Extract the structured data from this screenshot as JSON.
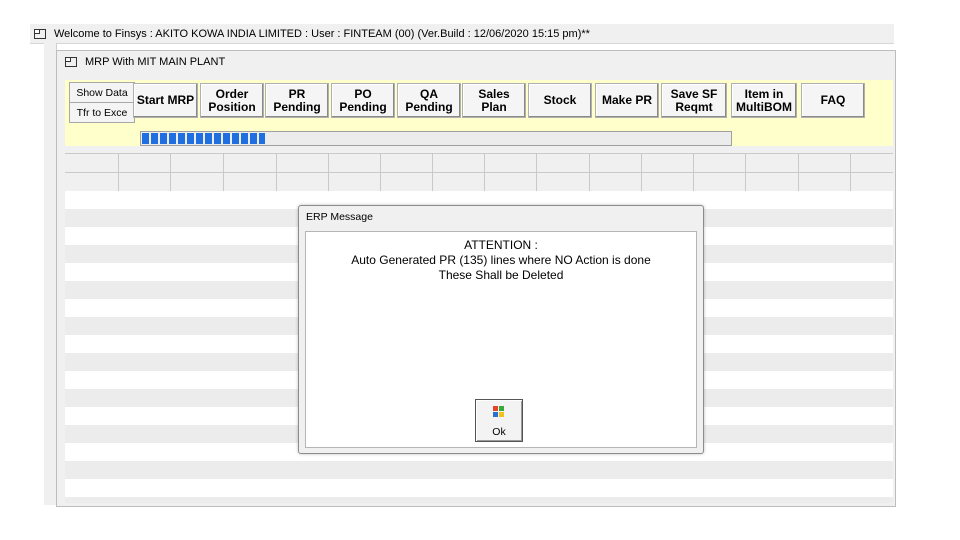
{
  "app": {
    "title": "Welcome to Finsys : AKITO KOWA INDIA LIMITED : User : FINTEAM (00) (Ver.Build : 12/06/2020  15:15 pm)**"
  },
  "window": {
    "title": "MRP With MIT MAIN PLANT"
  },
  "side_buttons": [
    "Show Data",
    "Tfr to Exce"
  ],
  "toolbar": [
    "Start MRP",
    "Order\nPosition",
    "PR\nPending",
    "PO\nPending",
    "QA\nPending",
    "Sales\nPlan",
    "Stock",
    "Make PR",
    "Save SF\nReqmt",
    "Item in\nMultiBOM",
    "FAQ"
  ],
  "progress": {
    "value": 0.21
  },
  "dialog": {
    "title": "ERP Message",
    "lines": [
      "ATTENTION :",
      "Auto Generated PR (135) lines where NO Action is done",
      "These Shall be Deleted"
    ],
    "ok_label": "Ok"
  },
  "colors": {
    "panel": "#ffffcc",
    "progress": "#1f6fe0",
    "flag_red": "#e8442c",
    "flag_green": "#3aa83a",
    "flag_blue": "#2b6fd6",
    "flag_yellow": "#f2c21b"
  }
}
